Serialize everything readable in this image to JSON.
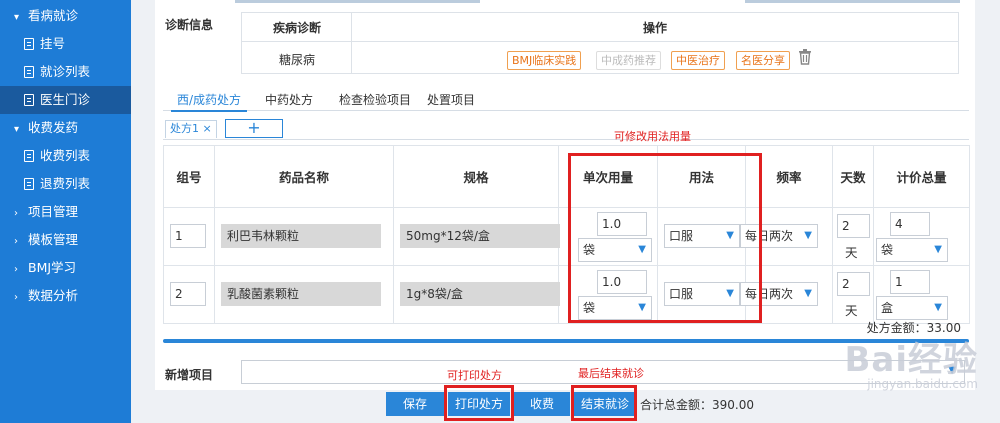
{
  "sidebar": {
    "items": [
      {
        "type": "group",
        "label": "看病就诊",
        "caret": "▾"
      },
      {
        "type": "sub",
        "label": "挂号"
      },
      {
        "type": "sub",
        "label": "就诊列表"
      },
      {
        "type": "sub",
        "label": "医生门诊",
        "active": true
      },
      {
        "type": "group",
        "label": "收费发药",
        "caret": "▾"
      },
      {
        "type": "sub",
        "label": "收费列表"
      },
      {
        "type": "sub",
        "label": "退费列表"
      },
      {
        "type": "group",
        "label": "项目管理",
        "caret": "›"
      },
      {
        "type": "group",
        "label": "模板管理",
        "caret": "›"
      },
      {
        "type": "group",
        "label": "BMJ学习",
        "caret": "›"
      },
      {
        "type": "group",
        "label": "数据分析",
        "caret": "›"
      }
    ]
  },
  "diagnosis": {
    "section_label": "诊断信息",
    "col_disease": "疾病诊断",
    "col_actions": "操作",
    "disease": "糖尿病",
    "actions": [
      "BMJ临床实践",
      "中成药推荐",
      "中医治疗",
      "名医分享"
    ]
  },
  "tabs": [
    "西/成药处方",
    "中药处方",
    "检查检验项目",
    "处置项目"
  ],
  "rx_tab": "处方1 ×",
  "rx_add": "+",
  "table": {
    "headers": [
      "组号",
      "药品名称",
      "规格",
      "单次用量",
      "用法",
      "频率",
      "天数",
      "计价总量"
    ],
    "rows": [
      {
        "group": "1",
        "name": "利巴韦林颗粒",
        "spec": "50mg*12袋/盒",
        "dose": "1.0",
        "dose_unit": "袋",
        "usage": "口服",
        "freq": "每日两次 ",
        "days": "2",
        "days_unit": "天",
        "qty": "4",
        "qty_unit": "袋"
      },
      {
        "group": "2",
        "name": "乳酸菌素颗粒",
        "spec": "1g*8袋/盒",
        "dose": "1.0",
        "dose_unit": "袋",
        "usage": "口服",
        "freq": "每日两次 ",
        "days": "2",
        "days_unit": "天",
        "qty": "1",
        "qty_unit": "盒"
      }
    ]
  },
  "rx_total": "处方金额：33.00",
  "new_item_label": "新增项目",
  "buttons": {
    "save": "保存",
    "print": "打印处方",
    "charge": "收费",
    "finish": "结束就诊"
  },
  "grand_total": "合计总金额：390.00",
  "annotations": {
    "modify": "可修改用法用量",
    "print": "可打印处方",
    "finish": "最后结束就诊"
  },
  "watermark": {
    "brand": "Bai经验",
    "url": "jingyan.baidu.com"
  },
  "colors": {
    "sidebar": "#1e7cd6",
    "active": "#1a5a9e",
    "accent": "#2a86d8",
    "annotation": "#e02020"
  }
}
